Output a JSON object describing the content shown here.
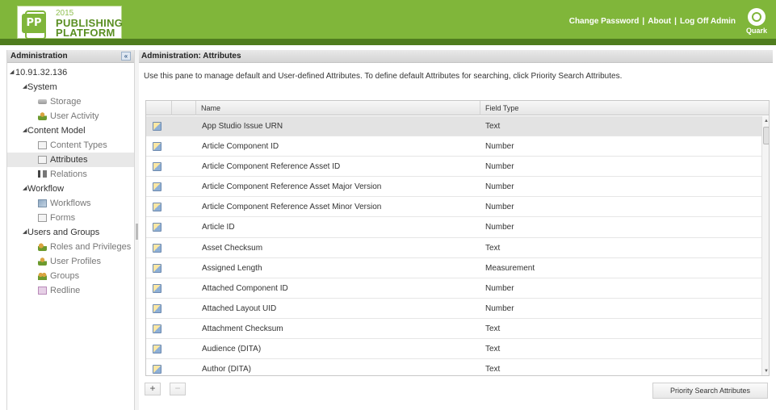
{
  "header": {
    "logo": {
      "mark": "PP",
      "year": "2015",
      "line1": "PUBLISHING",
      "line2": "PLATFORM"
    },
    "links": {
      "change_password": "Change Password",
      "about": "About",
      "log_off": "Log Off Admin",
      "separator": "|"
    },
    "brand": "Quark"
  },
  "sidebar": {
    "title": "Administration",
    "collapse_glyph": "«",
    "server": "10.91.32.136",
    "groups": [
      {
        "label": "System",
        "items": [
          {
            "label": "Storage",
            "icon": "storage-icon"
          },
          {
            "label": "User Activity",
            "icon": "user-activity-icon"
          }
        ]
      },
      {
        "label": "Content Model",
        "items": [
          {
            "label": "Content Types",
            "icon": "content-types-icon"
          },
          {
            "label": "Attributes",
            "icon": "attributes-icon",
            "selected": true
          },
          {
            "label": "Relations",
            "icon": "relations-icon"
          }
        ]
      },
      {
        "label": "Workflow",
        "items": [
          {
            "label": "Workflows",
            "icon": "workflows-icon"
          },
          {
            "label": "Forms",
            "icon": "forms-icon"
          }
        ]
      },
      {
        "label": "Users and Groups",
        "items": [
          {
            "label": "Roles and Privileges",
            "icon": "roles-icon"
          },
          {
            "label": "User Profiles",
            "icon": "user-profiles-icon"
          },
          {
            "label": "Groups",
            "icon": "groups-icon"
          },
          {
            "label": "Redline",
            "icon": "redline-icon"
          }
        ]
      }
    ]
  },
  "main": {
    "title": "Administration: Attributes",
    "description": "Use this pane to manage default and User-defined Attributes. To define default Attributes for searching, click Priority Search Attributes.",
    "columns": {
      "name": "Name",
      "field_type": "Field Type"
    },
    "rows": [
      {
        "name": "App Studio Issue URN",
        "type": "Text"
      },
      {
        "name": "Article Component ID",
        "type": "Number"
      },
      {
        "name": "Article Component Reference Asset ID",
        "type": "Number"
      },
      {
        "name": "Article Component Reference Asset Major Version",
        "type": "Number"
      },
      {
        "name": "Article Component Reference Asset Minor Version",
        "type": "Number"
      },
      {
        "name": "Article ID",
        "type": "Number"
      },
      {
        "name": "Asset Checksum",
        "type": "Text"
      },
      {
        "name": "Assigned Length",
        "type": "Measurement"
      },
      {
        "name": "Attached Component ID",
        "type": "Number"
      },
      {
        "name": "Attached Layout UID",
        "type": "Number"
      },
      {
        "name": "Attachment Checksum",
        "type": "Text"
      },
      {
        "name": "Audience (DITA)",
        "type": "Text"
      },
      {
        "name": "Author (DITA)",
        "type": "Text"
      }
    ],
    "buttons": {
      "add": "+",
      "remove": "−",
      "priority": "Priority Search Attributes"
    }
  }
}
